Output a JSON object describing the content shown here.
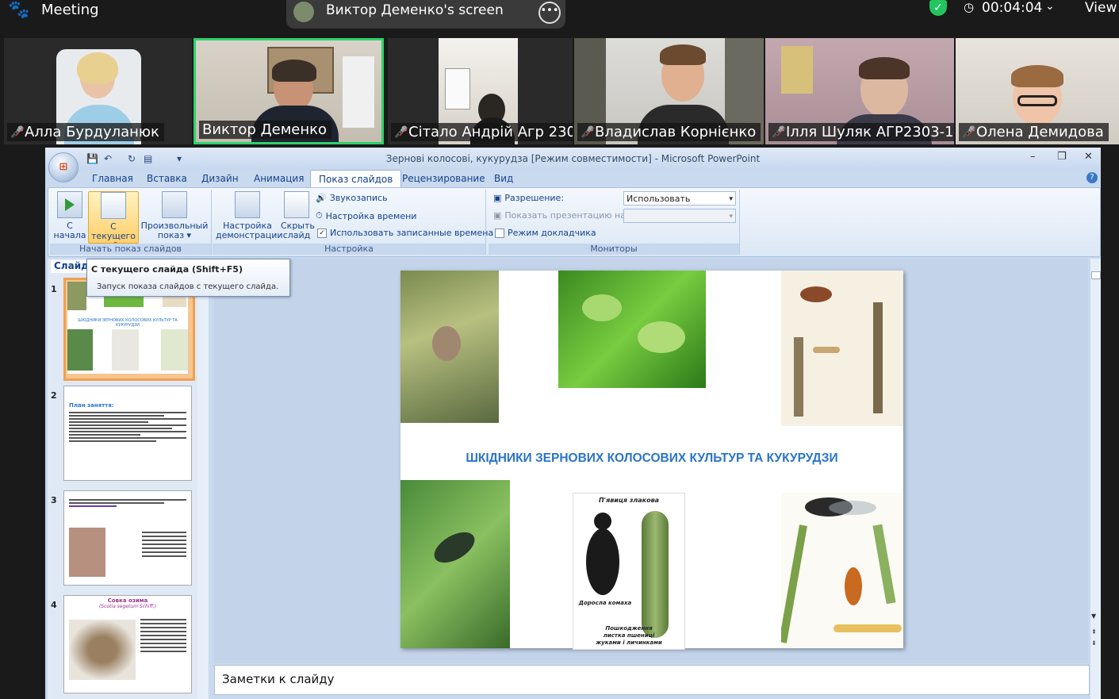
{
  "topbar": {
    "meeting_label": "Meeting",
    "screen_title": "Виктор Деменко's screen",
    "more_icon": "ellipsis-icon",
    "timer": "00:04:04",
    "view_label": "View",
    "shield_color": "#22c55e"
  },
  "participants": [
    {
      "name": "Алла Бурдуланюк",
      "muted": true
    },
    {
      "name": "Виктор Деменко",
      "muted": false,
      "active_speaker": true
    },
    {
      "name": "Сітало Андрій Агр 230...",
      "muted": true
    },
    {
      "name": "Владислав Корнієнко",
      "muted": true
    },
    {
      "name": "Ілля Шуляк АГР2303-1",
      "muted": true
    },
    {
      "name": "Олена Демидова",
      "muted": true
    }
  ],
  "ppt": {
    "window_title": "Зернові колосові, кукурудза [Режим совместимости] - Microsoft PowerPoint",
    "tabs": [
      "Главная",
      "Вставка",
      "Дизайн",
      "Анимация",
      "Показ слайдов",
      "Рецензирование",
      "Вид"
    ],
    "active_tab": "Показ слайдов",
    "groups": {
      "start": {
        "label": "Начать показ слайдов",
        "from_start": "С начала",
        "from_current": "С текущего слайда",
        "custom": "Произвольный показ"
      },
      "setup": {
        "label": "Настройка",
        "setup_show": "Настройка демонстрации",
        "hide_slide": "Скрыть слайд",
        "record": "Звукозапись",
        "timings": "Настройка времени",
        "use_timings": "Использовать записанные времена",
        "use_timings_checked": true
      },
      "monitors": {
        "label": "Мониторы",
        "resolution_label": "Разрешение:",
        "resolution_value": "Использовать текуще...",
        "show_on_label": "Показать презентацию на:",
        "presenter_view": "Режим докладчика",
        "presenter_checked": false
      }
    },
    "slides_tab": "Слайды",
    "tooltip": {
      "title": "С текущего слайда (Shift+F5)",
      "body": "Запуск показа слайдов с текущего слайда."
    },
    "thumbs": [
      {
        "num": "1",
        "caption": "ШКІДНИКИ ЗЕРНОВИХ КОЛОСОВИХ КУЛЬТУР ТА КУКУРУДЗИ"
      },
      {
        "num": "2",
        "heading": "План заняття:"
      },
      {
        "num": "3"
      },
      {
        "num": "4",
        "heading": "Совка озима",
        "sub": "(Scotia segetum Schiff.)"
      }
    ],
    "slide": {
      "title": "ШКІДНИКИ ЗЕРНОВИХ КОЛОСОВИХ КУЛЬТУР ТА КУКУРУДЗИ",
      "beetle_top": "П'явиця злакова",
      "beetle_adult": "Доросла комаха",
      "beetle_damage_1": "Пошкодження",
      "beetle_damage_2": "листка пшениці",
      "beetle_damage_3": "жуками і личинками"
    },
    "notes_placeholder": "Заметки к слайду"
  }
}
